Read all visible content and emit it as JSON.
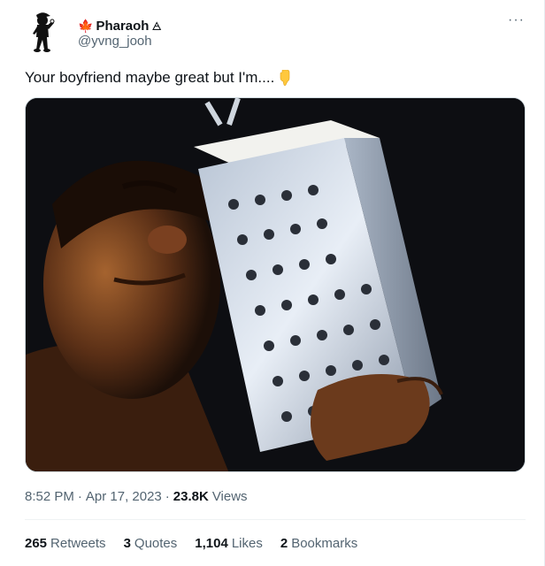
{
  "author": {
    "display_name": "Pharaoh",
    "handle": "@yvng_jooh",
    "leaf_emoji": "🍁",
    "name_glyph": "🜁",
    "avatar_icon": "hooded-figure-icon"
  },
  "tweet": {
    "text": "Your boyfriend maybe great but I'm....",
    "emoji_icon": "pointing-down-hand-icon",
    "media_description": "photo-man-with-cheese-grater"
  },
  "meta": {
    "time": "8:52 PM",
    "sep1": "·",
    "date": "Apr 17, 2023",
    "sep2": "·",
    "views_count": "23.8K",
    "views_label": "Views"
  },
  "stats": [
    {
      "count": "265",
      "label": "Retweets"
    },
    {
      "count": "3",
      "label": "Quotes"
    },
    {
      "count": "1,104",
      "label": "Likes"
    },
    {
      "count": "2",
      "label": "Bookmarks"
    }
  ],
  "more_label": "···",
  "colors": {
    "text_primary": "#0f1419",
    "text_secondary": "#536471",
    "divider": "#eff3f4",
    "leaf_red": "#e0245e",
    "emoji_yellow": "#ffc83d"
  }
}
